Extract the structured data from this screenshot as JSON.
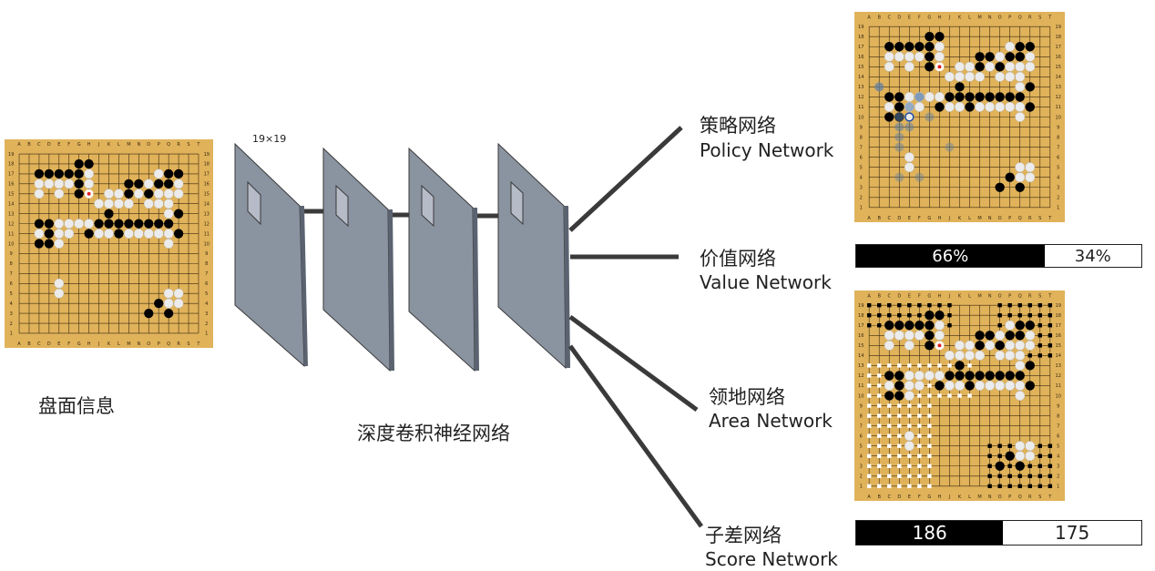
{
  "input": {
    "caption": "盘面信息"
  },
  "network": {
    "caption": "深度卷积神经网络",
    "size_label": "19×19"
  },
  "outputs": {
    "policy": {
      "cn": "策略网络",
      "en": "Policy Network"
    },
    "value": {
      "cn": "价值网络",
      "en": "Value Network",
      "black_pct": 66,
      "white_pct": 34,
      "black_label": "66%",
      "white_label": "34%"
    },
    "area": {
      "cn": "领地网络",
      "en": "Area Network"
    },
    "score": {
      "cn": "子差网络",
      "en": "Score Network",
      "black": 186,
      "white": 175,
      "black_label": "186",
      "white_label": "175"
    }
  },
  "board": {
    "columns": [
      "A",
      "B",
      "C",
      "D",
      "E",
      "F",
      "G",
      "H",
      "J",
      "K",
      "L",
      "M",
      "N",
      "O",
      "P",
      "Q",
      "R",
      "S",
      "T"
    ],
    "rows": [
      "19",
      "18",
      "17",
      "16",
      "15",
      "14",
      "13",
      "12",
      "11",
      "10",
      "9",
      "8",
      "7",
      "6",
      "5",
      "4",
      "3",
      "2",
      "1"
    ],
    "colors": {
      "wood": "#e0b25a",
      "line": "#3a2a10",
      "black": "#000000",
      "white": "#ececec",
      "last_move": "#e02020",
      "policy_hint": "#5b7fa8"
    }
  }
}
